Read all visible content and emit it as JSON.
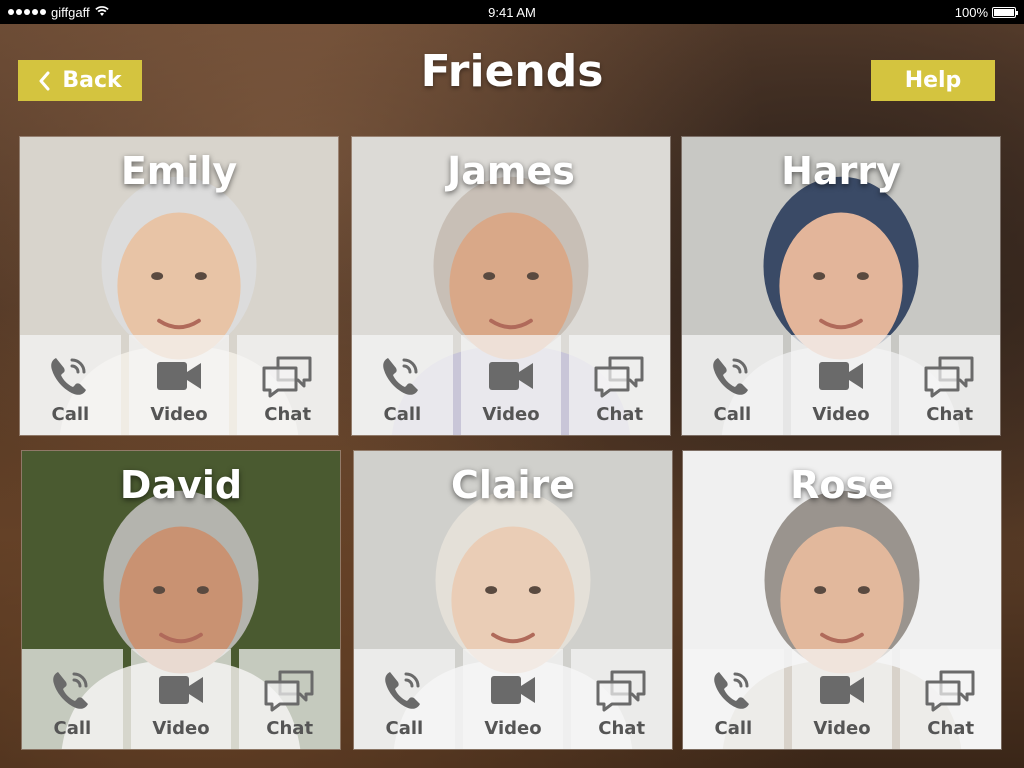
{
  "status": {
    "carrier": "giffgaff",
    "time": "9:41 AM",
    "battery": "100%"
  },
  "header": {
    "back_label": "Back",
    "title": "Friends",
    "help_label": "Help"
  },
  "actions": {
    "call": "Call",
    "video": "Video",
    "chat": "Chat"
  },
  "friends": [
    {
      "name": "Emily",
      "bg": "#d8d4cc",
      "skin": "#e8c4a6",
      "hair": "#dcdcdc",
      "shirt": "#f0ece4"
    },
    {
      "name": "James",
      "bg": "#dcdad6",
      "skin": "#d9a888",
      "hair": "#c8bfb6",
      "shirt": "#c9c6d8"
    },
    {
      "name": "Harry",
      "bg": "#c8c8c4",
      "skin": "#e3b59a",
      "hair": "#3a4a66",
      "shirt": "#e6e6e6"
    },
    {
      "name": "David",
      "bg": "#4a5a30",
      "skin": "#c99272",
      "hair": "#b4b4ae",
      "shirt": "#d6d6cc"
    },
    {
      "name": "Claire",
      "bg": "#d0d0cc",
      "skin": "#eacdb6",
      "hair": "#e4e0d8",
      "shirt": "#efefef"
    },
    {
      "name": "Rose",
      "bg": "#f0f0f0",
      "skin": "#e2b89c",
      "hair": "#9a948e",
      "shirt": "#d8d2ca"
    }
  ],
  "colors": {
    "accent": "#d4c43f",
    "icon": "#6a6a6a"
  }
}
